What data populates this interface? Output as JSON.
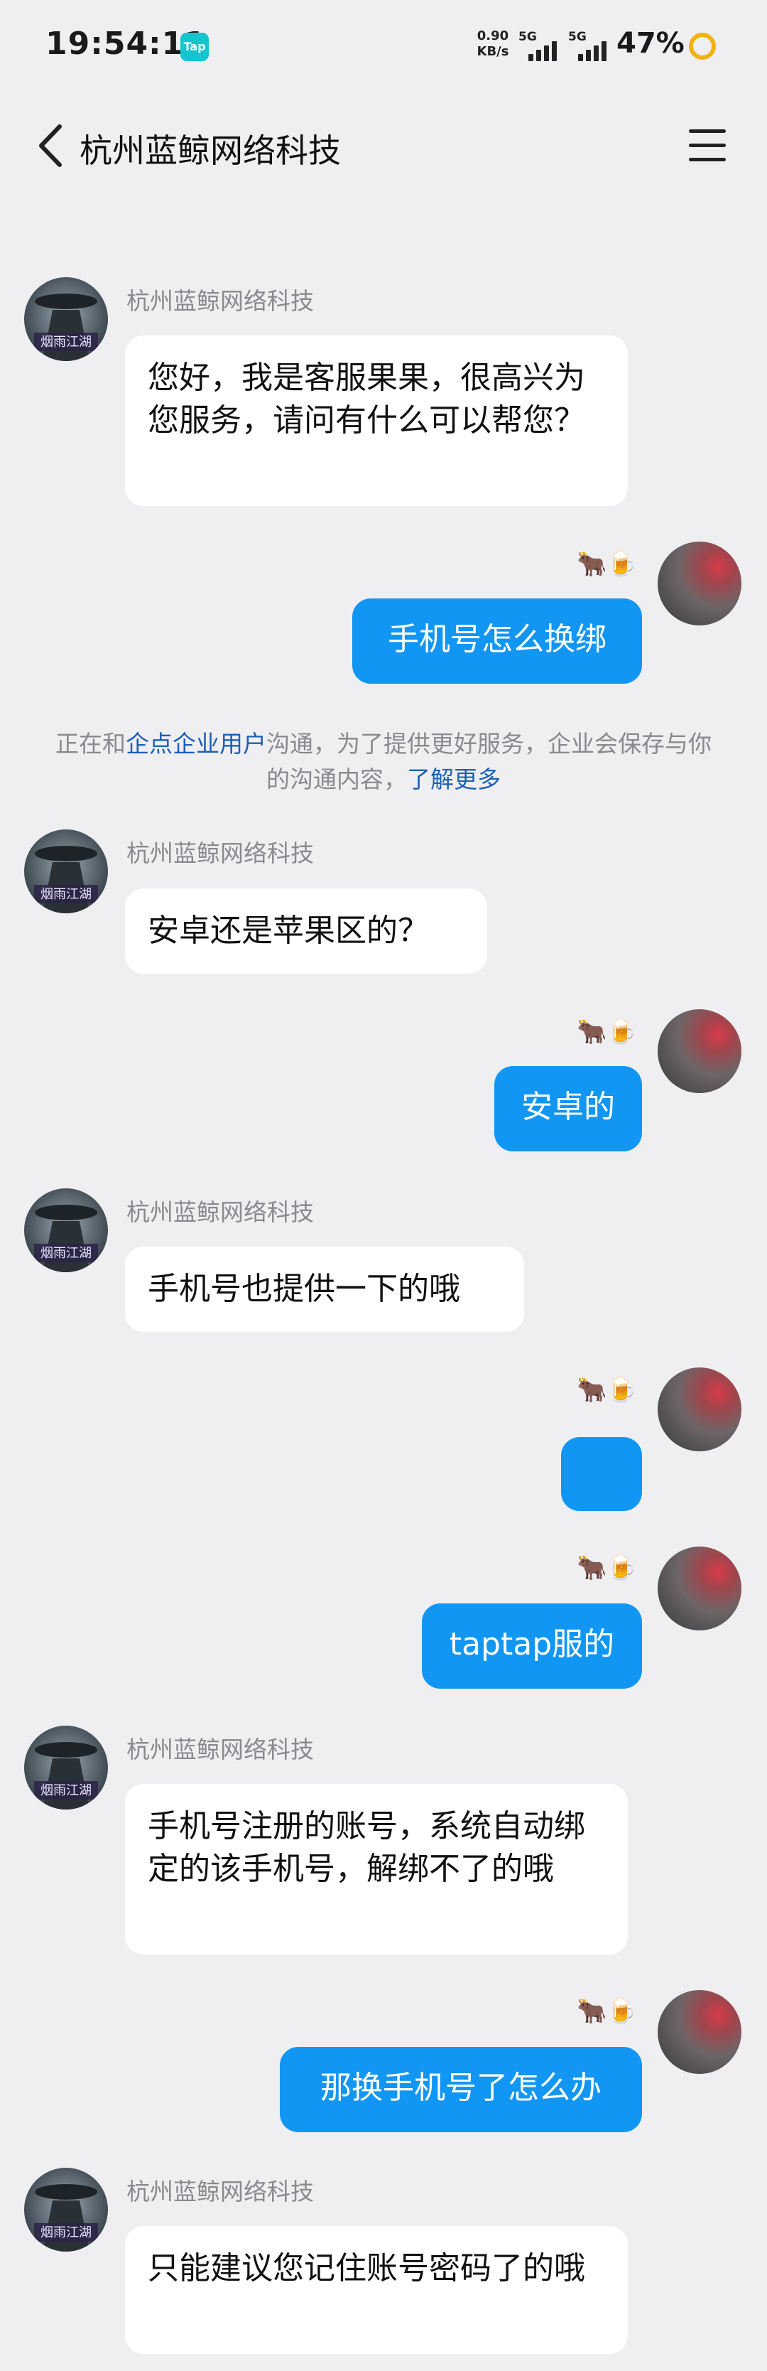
{
  "status_bar": {
    "time": "19:54:11",
    "app_badge": "Tap",
    "net_speed_value": "0.90",
    "net_speed_unit": "KB/s",
    "signal_1_label": "5G",
    "signal_2_label": "5G",
    "battery_percent": "47%"
  },
  "nav": {
    "title": "杭州蓝鲸网络科技"
  },
  "chat": {
    "sender_name": "杭州蓝鲸网络科技",
    "user_badge": "🐂🍺",
    "messages": [
      {
        "text": "您好，我是客服果果，很高兴为您服务，请问有什么可以帮您？"
      },
      {
        "text": "手机号怎么换绑"
      },
      {
        "text": "安卓还是苹果区的？"
      },
      {
        "text": "安卓的"
      },
      {
        "text": "手机号也提供一下的哦"
      },
      {
        "text": ""
      },
      {
        "text": "taptap服的"
      },
      {
        "text": "手机号注册的账号，系统自动绑定的该手机号，解绑不了的哦"
      },
      {
        "text": "那换手机号了怎么办"
      },
      {
        "text": "只能建议您记住账号密码了的哦"
      }
    ],
    "system_note": {
      "prefix": "正在和",
      "org_link": "企点企业用户",
      "middle": "沟通，为了提供更好服务，企业会保存与你的沟通内容，",
      "learn_more": "了解更多"
    }
  },
  "colors": {
    "outgoing_bubble": "#1296f3",
    "incoming_bubble": "#ffffff",
    "background": "#efeff2",
    "link": "#1d5fb6"
  }
}
